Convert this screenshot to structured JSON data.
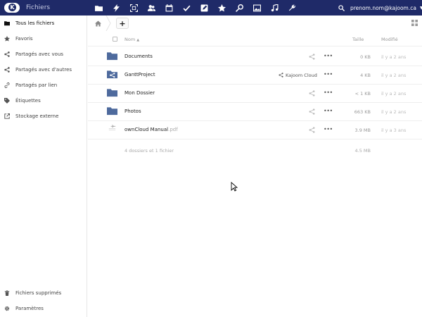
{
  "header": {
    "app_name": "Fichiers",
    "user": "prenom.nom@kajoom.ca",
    "apps": [
      "folder-icon",
      "lightning-icon",
      "expand-icon",
      "contacts-icon",
      "calendar-icon",
      "check-icon",
      "edit-icon",
      "star-icon",
      "key-icon",
      "image-icon",
      "music-icon",
      "wrench-icon"
    ],
    "accent": "#1f2a68"
  },
  "sidebar": {
    "items": [
      {
        "label": "Tous les fichiers",
        "icon": "folder-icon"
      },
      {
        "label": "Favoris",
        "icon": "star-icon"
      },
      {
        "label": "Partagés avec vous",
        "icon": "share-icon"
      },
      {
        "label": "Partagés avec d'autres",
        "icon": "share-icon"
      },
      {
        "label": "Partagés par lien",
        "icon": "link-icon"
      },
      {
        "label": "Étiquettes",
        "icon": "tag-icon"
      },
      {
        "label": "Stockage externe",
        "icon": "external-icon"
      }
    ],
    "trash": {
      "label": "Fichiers supprimés",
      "icon": "trash-icon"
    },
    "settings": {
      "label": "Paramètres",
      "icon": "gear-icon"
    }
  },
  "toolbar": {
    "new_label": "+"
  },
  "table": {
    "col_name": "Nom",
    "col_sort": "▲",
    "col_size": "Taille",
    "col_modified": "Modifié",
    "rows": [
      {
        "name": "Documents",
        "ext": "",
        "type": "folder",
        "share": "",
        "size": "0 KB",
        "modified": "il y a 2 ans"
      },
      {
        "name": "GanttProject",
        "ext": "",
        "type": "shared-folder",
        "share": "Kajoom Cloud",
        "size": "4 KB",
        "modified": "il y a 2 ans"
      },
      {
        "name": "Mon Dossier",
        "ext": "",
        "type": "folder",
        "share": "",
        "size": "< 1 KB",
        "modified": "il y a 2 ans"
      },
      {
        "name": "Photos",
        "ext": "",
        "type": "folder",
        "share": "",
        "size": "663 KB",
        "modified": "il y a 2 ans"
      },
      {
        "name": "ownCloud Manual",
        "ext": ".pdf",
        "type": "file",
        "share": "",
        "size": "3.9 MB",
        "modified": "il y a 3 ans"
      }
    ],
    "summary_count": "4 dossiers et 1 fichier",
    "summary_total": "4.5 MB"
  }
}
